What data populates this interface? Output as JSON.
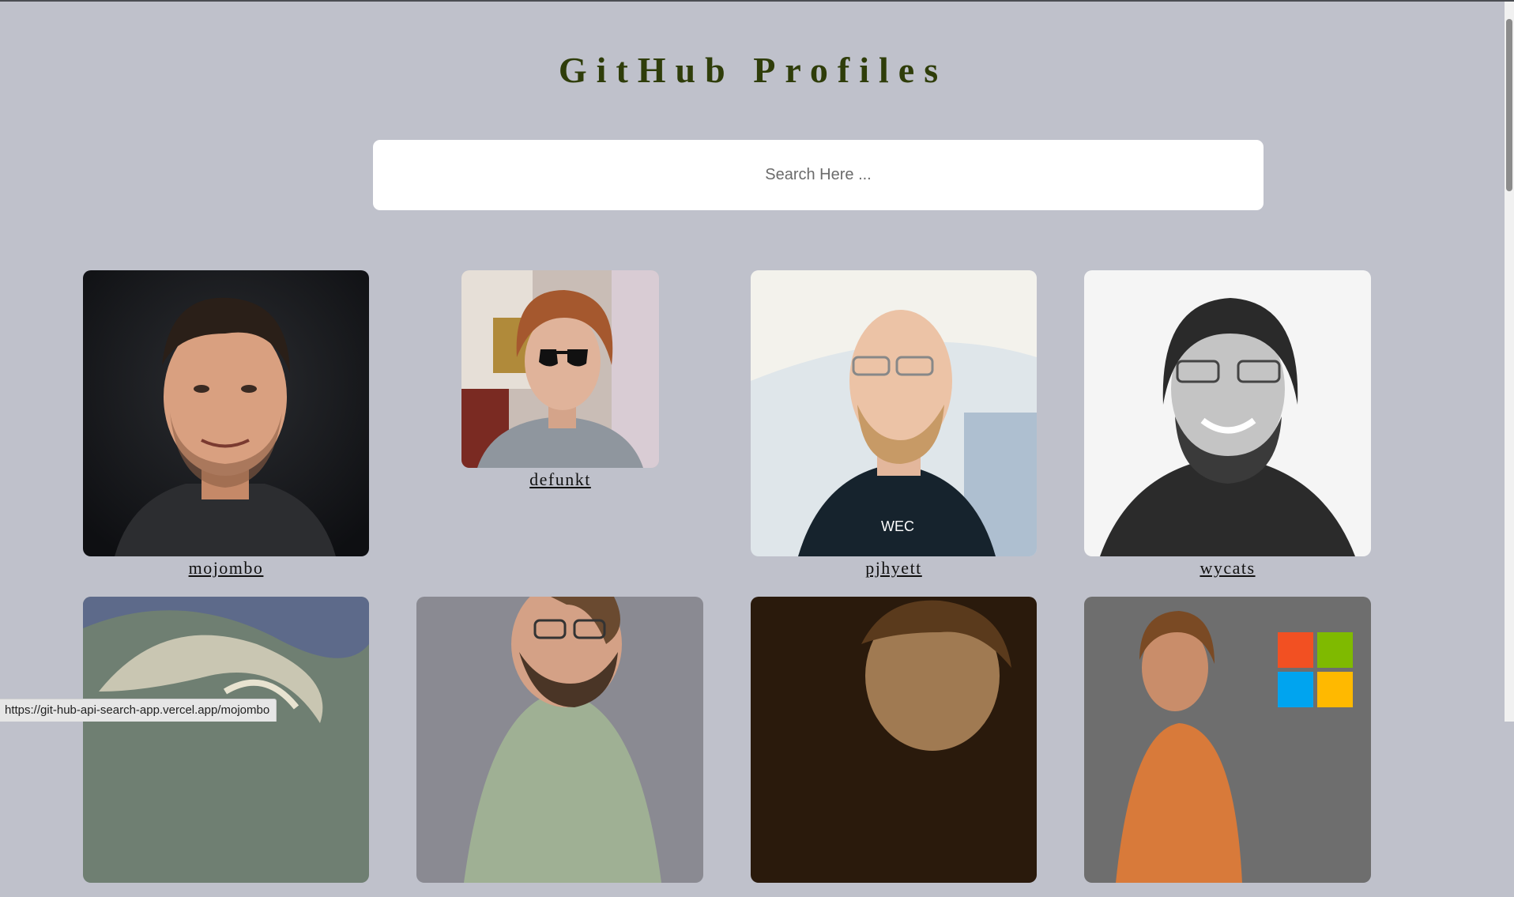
{
  "header": {
    "title": "GitHub Profiles"
  },
  "search": {
    "placeholder": "Search Here ..."
  },
  "profiles": [
    {
      "username": "mojombo"
    },
    {
      "username": "defunkt"
    },
    {
      "username": "pjhyett"
    },
    {
      "username": "wycats"
    },
    {
      "username": ""
    },
    {
      "username": ""
    },
    {
      "username": ""
    },
    {
      "username": ""
    }
  ],
  "statusbar": {
    "url": "https://git-hub-api-search-app.vercel.app/mojombo"
  },
  "colors": {
    "background": "#bfc1cb",
    "title": "#2f3d0a",
    "search_bg": "#ffffff"
  }
}
